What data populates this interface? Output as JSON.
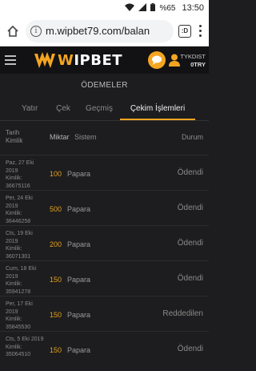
{
  "statusbar": {
    "battery": "%65",
    "time": "13:50"
  },
  "browser": {
    "url": "m.wipbet79.com/balan"
  },
  "site": {
    "logo_prefix": "W",
    "logo_main": "IPBET",
    "username": "TYKDIST",
    "balance": "0TRY"
  },
  "page": {
    "section_title": "ÖDEMELER",
    "tabs": [
      {
        "label": "Yatır"
      },
      {
        "label": "Çek"
      },
      {
        "label": "Geçmiş"
      },
      {
        "label": "Çekim İşlemleri"
      }
    ]
  },
  "table": {
    "headers": {
      "date_line1": "Tarih",
      "date_line2": "Kimlik",
      "amount": "Miktar",
      "system": "Sistem",
      "status": "Durum"
    },
    "rows": [
      {
        "date1": "Paz, 27 Eki",
        "date2": "2019",
        "date3": "Kimlik:",
        "date4": "36675116",
        "amount": "100",
        "system": "Papara",
        "status": "Ödendi"
      },
      {
        "date1": "Per, 24 Eki",
        "date2": "2019",
        "date3": "Kimlik:",
        "date4": "36446258",
        "amount": "500",
        "system": "Papara",
        "status": "Ödendi"
      },
      {
        "date1": "Cts, 19 Eki",
        "date2": "2019",
        "date3": "Kimlik:",
        "date4": "36071301",
        "amount": "200",
        "system": "Papara",
        "status": "Ödendi"
      },
      {
        "date1": "Cum, 18 Eki",
        "date2": "2019",
        "date3": "Kimlik:",
        "date4": "35941278",
        "amount": "150",
        "system": "Papara",
        "status": "Ödendi"
      },
      {
        "date1": "Per, 17 Eki",
        "date2": "2019",
        "date3": "Kimlik:",
        "date4": "35845530",
        "amount": "150",
        "system": "Papara",
        "status": "Reddedilen"
      },
      {
        "date1": "Cts, 5 Eki 2019",
        "date2": "Kimlik:",
        "date3": "35064510",
        "date4": "",
        "amount": "150",
        "system": "Papara",
        "status": "Ödendi"
      }
    ]
  },
  "colors": {
    "accent": "#f4a521",
    "background": "#1d1d1f",
    "header": "#121214"
  }
}
